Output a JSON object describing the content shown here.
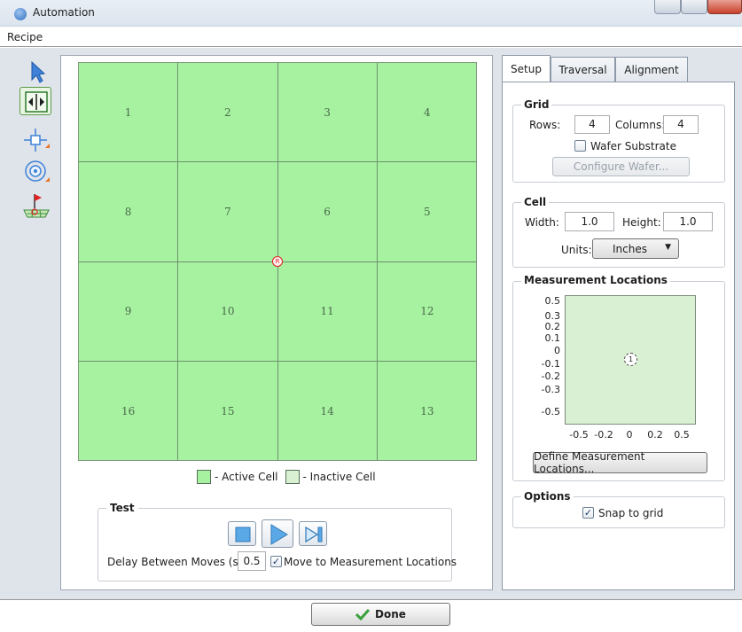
{
  "window": {
    "title": "Automation"
  },
  "menu": {
    "recipe": "Recipe"
  },
  "colors": {
    "active_cell": "#a6f2a0",
    "inactive_cell": "#d9f0d2",
    "marker": "#e02020"
  },
  "grid": {
    "cells": [
      [
        "1",
        "2",
        "3",
        "4"
      ],
      [
        "8",
        "7",
        "6",
        "5"
      ],
      [
        "9",
        "10",
        "11",
        "12"
      ],
      [
        "16",
        "15",
        "14",
        "13"
      ]
    ],
    "origin_marker": "R"
  },
  "legend": {
    "active": "- Active Cell",
    "inactive": "- Inactive Cell"
  },
  "test": {
    "title": "Test",
    "delay_label": "Delay Between Moves (s):",
    "delay_value": "0.5",
    "move_to_label": "Move to Measurement Locations",
    "move_to_checked": true
  },
  "tabs": [
    "Setup",
    "Traversal",
    "Alignment"
  ],
  "setup": {
    "grid_group": {
      "title": "Grid",
      "rows_label": "Rows:",
      "rows_value": "4",
      "columns_label": "Columns:",
      "columns_value": "4",
      "wafer_label": "Wafer Substrate",
      "wafer_checked": false,
      "configure_button": "Configure Wafer..."
    },
    "cell_group": {
      "title": "Cell",
      "width_label": "Width:",
      "width_value": "1.0",
      "height_label": "Height:",
      "height_value": "1.0",
      "units_label": "Units:",
      "units_value": "Inches"
    },
    "measurement_group": {
      "title": "Measurement Locations",
      "y_ticks": [
        "0.5",
        "0.3",
        "0.2",
        "0.1",
        "0",
        "-0.1",
        "-0.2",
        "-0.3",
        "-0.5"
      ],
      "x_ticks": [
        "-0.5",
        "-0.2",
        "0",
        "0.2",
        "0.5"
      ],
      "point_label": "1",
      "define_button": "Define Measurement Locations..."
    },
    "options_group": {
      "title": "Options",
      "snap_label": "Snap to grid",
      "snap_checked": true
    }
  },
  "done_button": "Done"
}
